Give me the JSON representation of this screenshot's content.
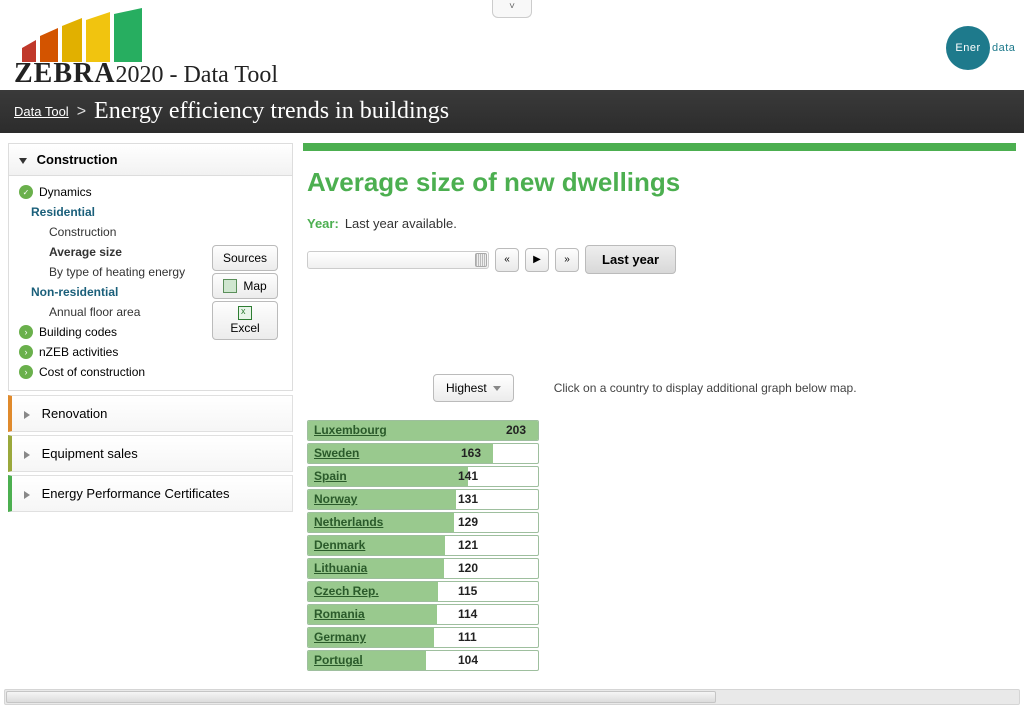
{
  "app": {
    "brand_bold": "ZEBRA",
    "brand_year": "2020",
    "brand_suffix": " - Data Tool",
    "ener_prefix": "Ener",
    "ener_suffix": "data"
  },
  "breadcrumb": {
    "root": "Data Tool",
    "sep": ">",
    "title": "Energy efficiency trends in buildings"
  },
  "sidebar": {
    "construction_header": "Construction",
    "dynamics": "Dynamics",
    "residential": "Residential",
    "construction_item": "Construction",
    "average_size": "Average size",
    "heating": "By type of heating energy",
    "nonres": "Non-residential",
    "annual_floor": "Annual floor area",
    "building_codes": "Building codes",
    "nzeb": "nZEB activities",
    "cost": "Cost of construction",
    "renovation": "Renovation",
    "equipment": "Equipment sales",
    "epc": "Energy Performance Certificates"
  },
  "accent": {
    "renovation": "#e08a2c",
    "equipment": "#9aa83b",
    "epc": "#4caf50"
  },
  "buttons": {
    "sources": "Sources",
    "map": "Map",
    "excel": "Excel"
  },
  "page": {
    "title": "Average size of new dwellings",
    "year_label": "Year:",
    "year_desc": "Last year available.",
    "last_year": "Last year",
    "highest": "Highest",
    "hint": "Click on a country to display additional graph below map."
  },
  "chart_data": {
    "type": "bar",
    "orientation": "horizontal",
    "title": "Average size of new dwellings",
    "sort": "Highest",
    "xlim": [
      0,
      203
    ],
    "categories": [
      "Luxembourg",
      "Sweden",
      "Spain",
      "Norway",
      "Netherlands",
      "Denmark",
      "Lithuania",
      "Czech Rep.",
      "Romania",
      "Germany",
      "Portugal"
    ],
    "values": [
      203,
      163,
      141,
      131,
      129,
      121,
      120,
      115,
      114,
      111,
      104
    ]
  }
}
